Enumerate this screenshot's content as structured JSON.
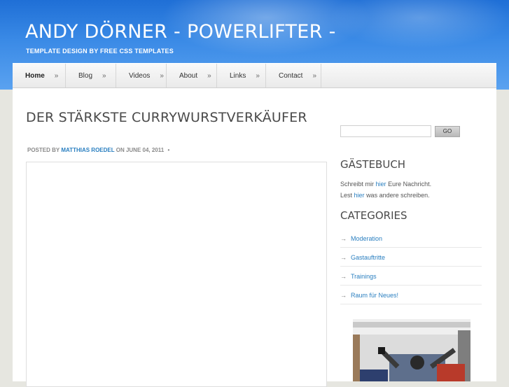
{
  "header": {
    "title": "ANDY DÖRNER - POWERLIFTER -",
    "tagline": "TEMPLATE DESIGN BY FREE CSS TEMPLATES"
  },
  "menu": {
    "raquo": "»",
    "items": [
      {
        "label": "Home"
      },
      {
        "label": "Blog"
      },
      {
        "label": "Videos"
      },
      {
        "label": "About"
      },
      {
        "label": "Links"
      },
      {
        "label": "Contact"
      }
    ]
  },
  "post": {
    "title": "DER STÄRKSTE CURRYWURSTVERKÄUFER",
    "meta_prefix": "POSTED BY",
    "author": "MATTHIAS ROEDEL",
    "meta_on": "ON JUNE 04, 2011",
    "meta_sep": "•"
  },
  "sidebar": {
    "search": {
      "value": "",
      "button_label": "GO"
    },
    "guestbook": {
      "heading": "GÄSTEBUCH",
      "line1_prefix": "Schreibt mir",
      "line1_link": "hier",
      "line1_suffix": "Eure Nachricht.",
      "line2_prefix": "Lest",
      "line2_link": "hier",
      "line2_suffix": "was andere schreiben."
    },
    "categories": {
      "heading": "CATEGORIES",
      "arrow": "→",
      "items": [
        {
          "label": "Moderation"
        },
        {
          "label": "Gastauftritte"
        },
        {
          "label": "Trainings"
        },
        {
          "label": "Raum für Neues!"
        }
      ]
    }
  },
  "colors": {
    "header_blue": "#2f7fe0",
    "link_blue": "#2a7fc0",
    "page_bg": "#e6e6e0"
  }
}
